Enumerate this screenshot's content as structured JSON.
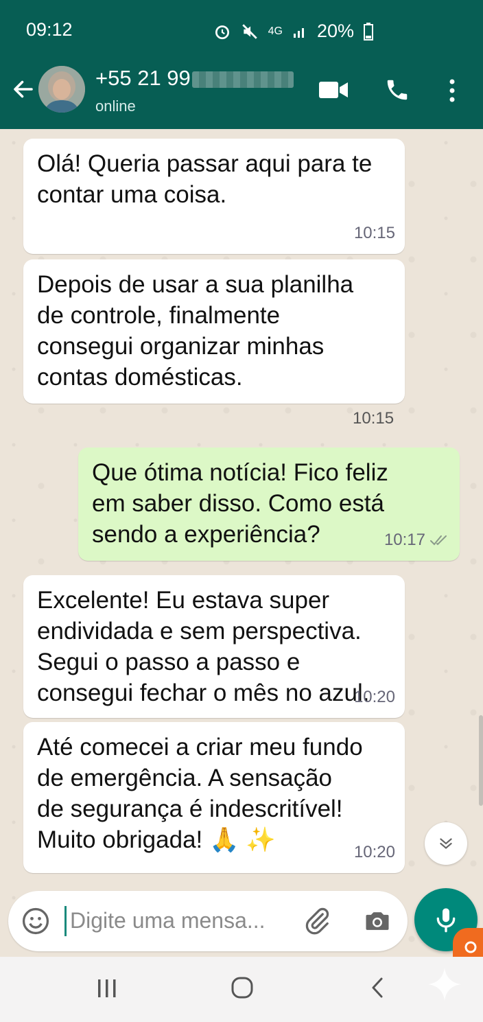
{
  "status_bar": {
    "time": "09:12",
    "network": "4G",
    "battery": "20%"
  },
  "header": {
    "contact_number": "+55 21 99",
    "contact_status": "online"
  },
  "messages": [
    {
      "direction": "in",
      "text": "Olá! Queria passar aqui para te\ncontar uma coisa.",
      "time": "10:15"
    },
    {
      "direction": "in",
      "text": "Depois de usar a sua planilha\nde controle, finalmente\nconsegui organizar minhas\ncontas domésticas.",
      "time": "10:15"
    },
    {
      "direction": "out",
      "text": "Que ótima notícia! Fico feliz\nem saber disso. Como está\nsendo a experiência?",
      "time": "10:17",
      "read": true
    },
    {
      "direction": "in",
      "text": "Excelente! Eu estava super\nendividada e sem perspectiva.\nSegui o passo a passo e\nconsegui fechar o mês no azul.",
      "time": "10:20"
    },
    {
      "direction": "in",
      "text": "Até comecei a criar meu fundo\nde emergência. A sensação\nde segurança é indescritível!\nMuito obrigada! 🙏 ✨",
      "time": "10:20"
    }
  ],
  "composer": {
    "placeholder": "Digite uma mensa..."
  },
  "colors": {
    "header": "#075e54",
    "outgoing_bubble": "#dcf8c6",
    "accent": "#00897b"
  },
  "icons": [
    "back-arrow-icon",
    "video-call-icon",
    "phone-icon",
    "more-vert-icon",
    "emoji-icon",
    "attach-icon",
    "camera-icon",
    "mic-icon",
    "scroll-down-icon"
  ]
}
